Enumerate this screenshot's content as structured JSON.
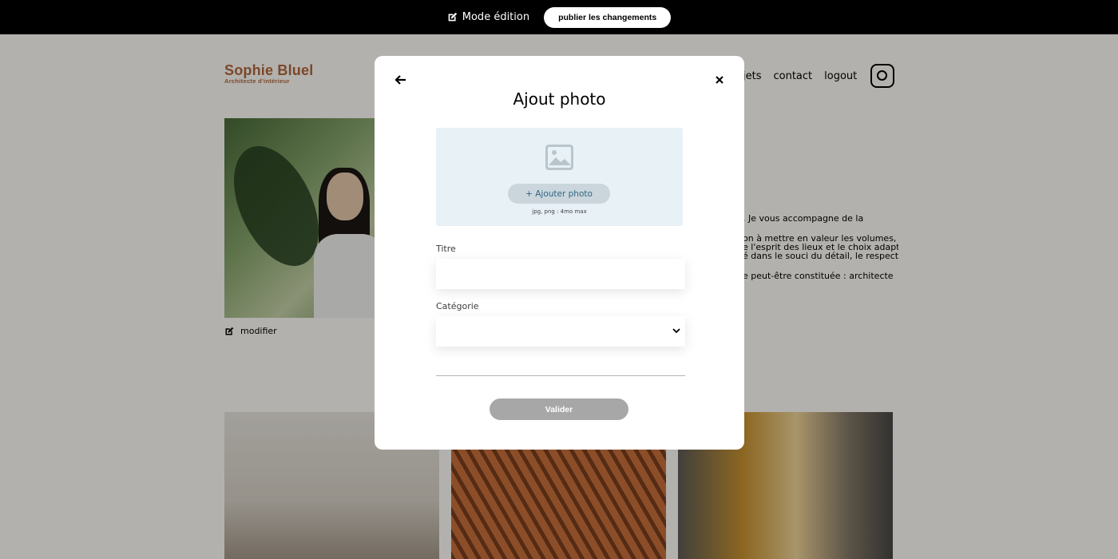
{
  "edit_bar": {
    "mode_label": "Mode édition",
    "publish_label": "publier les changements",
    "icon": "edit-icon"
  },
  "header": {
    "logo_name": "Sophie Bluel",
    "logo_sub": "Architecte d'intérieur",
    "nav": [
      "jets",
      "contact",
      "logout"
    ],
    "instagram_icon": "instagram-icon"
  },
  "intro": {
    "modify_label": "modifier",
    "paragraphs": [
      ". Je vous accompagne de la",
      "on à mettre en valeur les volumes,",
      "e l'esprit des lieux et le choix adapté",
      "é dans le souci du détail, le respect",
      "e peut-être constituée : architecte"
    ]
  },
  "modal": {
    "title": "Ajout photo",
    "upload_button": "+ Ajouter photo",
    "upload_hint": "jpg, png : 4mo max",
    "title_label": "Titre",
    "category_label": "Catégorie",
    "validate_label": "Valider",
    "title_value": "",
    "category_value": ""
  },
  "colors": {
    "brand": "#b1663c",
    "upload_bg": "#e8f1f6",
    "button_disabled": "#a7a7a7"
  }
}
